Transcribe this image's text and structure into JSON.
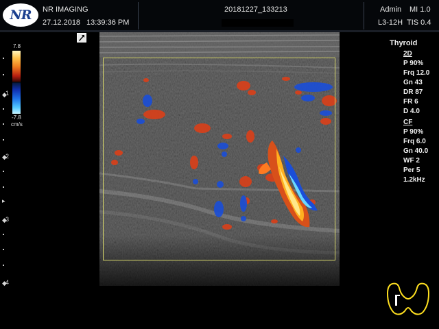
{
  "header": {
    "logo": "NR",
    "institution": "NR IMAGING",
    "date": "27.12.2018",
    "time": "13:39:36 PM",
    "study_id": "20181227_133213",
    "operator": "Admin",
    "mi": "MI 1.0",
    "probe": "L3-12H",
    "tis": "TIS 0.4"
  },
  "colorbar": {
    "max": "7.8",
    "min": "-7.8",
    "unit": "cm/s"
  },
  "exam": {
    "preset": "Thyroid",
    "mode_2d": {
      "label": "2D",
      "params": [
        "P 90%",
        "Frq 12.0",
        "Gn 43",
        "DR 87",
        "FR 6",
        "D 4.0"
      ]
    },
    "mode_cf": {
      "label": "CF",
      "params": [
        "P 90%",
        "Frq 6.0",
        "Gn 40.0",
        "WF 2",
        "Per 5",
        "1.2kHz"
      ]
    }
  },
  "depth_scale": {
    "labels": [
      "1",
      "2",
      "3",
      "4"
    ]
  },
  "icons": {
    "logo": "nr-logo-icon",
    "orientation": "probe-orientation-icon",
    "bodymark": "thyroid-bodymark-icon"
  },
  "colors": {
    "roi_box": "#d8d86a",
    "doppler_red": "#d8401a",
    "doppler_blue": "#1a4ed8"
  }
}
